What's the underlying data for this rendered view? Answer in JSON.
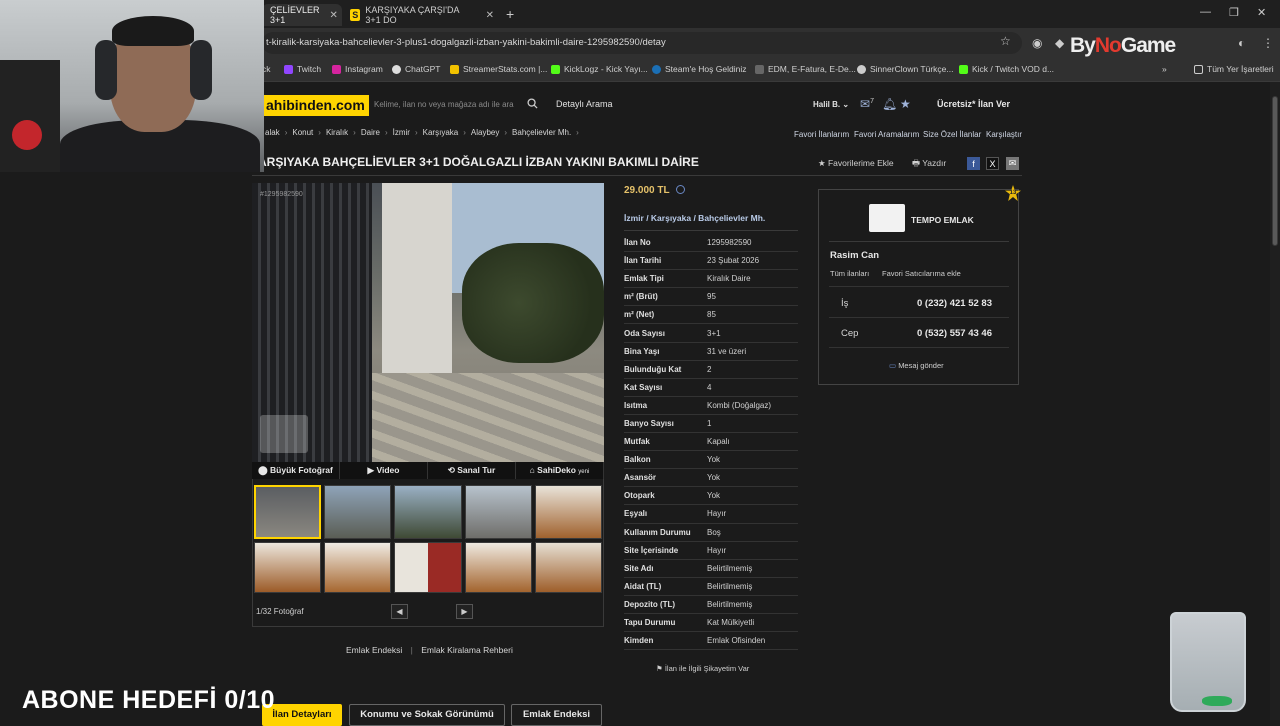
{
  "browser": {
    "tabs": [
      {
        "label": "ÇELİEVLER 3+1"
      },
      {
        "label": "KARŞIYAKA ÇARŞI'DA 3+1 DO",
        "favicon": "S"
      }
    ],
    "url": "t-kiralik-karsiyaka-bahcelievler-3-plus1-dogalgazli-izban-yakini-bakimli-daire-1295982590/detay",
    "bookmarks": [
      "ck",
      "Twitch",
      "Instagram",
      "ChatGPT",
      "StreamerStats.com |...",
      "KickLogz - Kick Yayı...",
      "Steam'e Hoş Geldiniz",
      "EDM, E-Fatura, E-De...",
      "SinnerClown Türkçe...",
      "Kick / Twitch VOD d...",
      "»",
      "Tüm Yer İşaretleri"
    ],
    "overlay_logo": {
      "by": "By",
      "no": "No",
      "game": "Game"
    }
  },
  "header": {
    "logo": "ahibinden.com",
    "search_placeholder": "Kelime, ilan no veya mağaza adı ile ara",
    "detailed_search": "Detaylı Arama",
    "user": "Halil B. ⌄",
    "message_count": "7",
    "post_free": "Ücretsiz* İlan Ver"
  },
  "breadcrumbs": [
    "alak",
    "Konut",
    "Kiralık",
    "Daire",
    "İzmir",
    "Karşıyaka",
    "Alaybey",
    "Bahçelievler Mh."
  ],
  "top_links": [
    "Favori İlanlarım",
    "Favori Aramalarım",
    "Size Özel İlanlar",
    "Karşılaştır"
  ],
  "listing": {
    "title": "ARŞIYAKA BAHÇELİEVLER 3+1 DOĞALGAZLI İZBAN YAKINI BAKIMLI DAİRE",
    "add_favorite": "Favorilerime Ekle",
    "print": "Yazdır",
    "photo_id": "#1295982590",
    "photo_tabs": [
      "Büyük Fotoğraf",
      "Video",
      "Sanal Tur",
      "SahiDeko"
    ],
    "photo_tab_new": "yeni",
    "photo_counter": "1/32 Fotoğraf",
    "price": "29.000 TL",
    "location": "İzmir  /  Karşıyaka  /  Bahçelievler Mh.",
    "details": [
      {
        "k": "İlan No",
        "v": "1295982590"
      },
      {
        "k": "İlan Tarihi",
        "v": "23 Şubat 2026"
      },
      {
        "k": "Emlak Tipi",
        "v": "Kiralık Daire"
      },
      {
        "k": "m² (Brüt)",
        "v": "95"
      },
      {
        "k": "m² (Net)",
        "v": "85"
      },
      {
        "k": "Oda Sayısı",
        "v": "3+1"
      },
      {
        "k": "Bina Yaşı",
        "v": "31 ve üzeri"
      },
      {
        "k": "Bulunduğu Kat",
        "v": "2"
      },
      {
        "k": "Kat Sayısı",
        "v": "4"
      },
      {
        "k": "Isıtma",
        "v": "Kombi (Doğalgaz)"
      },
      {
        "k": "Banyo Sayısı",
        "v": "1"
      },
      {
        "k": "Mutfak",
        "v": "Kapalı"
      },
      {
        "k": "Balkon",
        "v": "Yok"
      },
      {
        "k": "Asansör",
        "v": "Yok"
      },
      {
        "k": "Otopark",
        "v": "Yok"
      },
      {
        "k": "Eşyalı",
        "v": "Hayır"
      },
      {
        "k": "Kullanım Durumu",
        "v": "Boş"
      },
      {
        "k": "Site İçerisinde",
        "v": "Hayır"
      },
      {
        "k": "Site Adı",
        "v": "Belirtilmemiş"
      },
      {
        "k": "Aidat (TL)",
        "v": "Belirtilmemiş"
      },
      {
        "k": "Depozito (TL)",
        "v": "Belirtilmemiş"
      },
      {
        "k": "Tapu Durumu",
        "v": "Kat Mülkiyetli"
      },
      {
        "k": "Kimden",
        "v": "Emlak Ofisinden"
      }
    ],
    "complaint": "İlan ile İlgili Şikayetim Var",
    "below_links": [
      "Emlak Endeksi",
      "Emlak Kiralama Rehberi"
    ]
  },
  "seller": {
    "firm": "TEMPO EMLAK",
    "badge": "13",
    "name": "Rasim Can",
    "all_listings": "Tüm ilanları",
    "fav_seller": "Favori Satıcılarıma ekle",
    "phones": [
      {
        "label": "İş",
        "number": "0 (232) 421 52 83"
      },
      {
        "label": "Cep",
        "number": "0 (532) 557 43 46"
      }
    ],
    "message": "Mesaj gönder"
  },
  "bottom_tabs": [
    "İlan Detayları",
    "Konumu ve Sokak Görünümü",
    "Emlak Endeksi"
  ],
  "overlay": {
    "subscriber_goal": "ABONE HEDEFİ 0/10"
  },
  "colors": {
    "brand": "#ffd400",
    "price": "#e6c26a",
    "link": "#b9cbe8"
  }
}
